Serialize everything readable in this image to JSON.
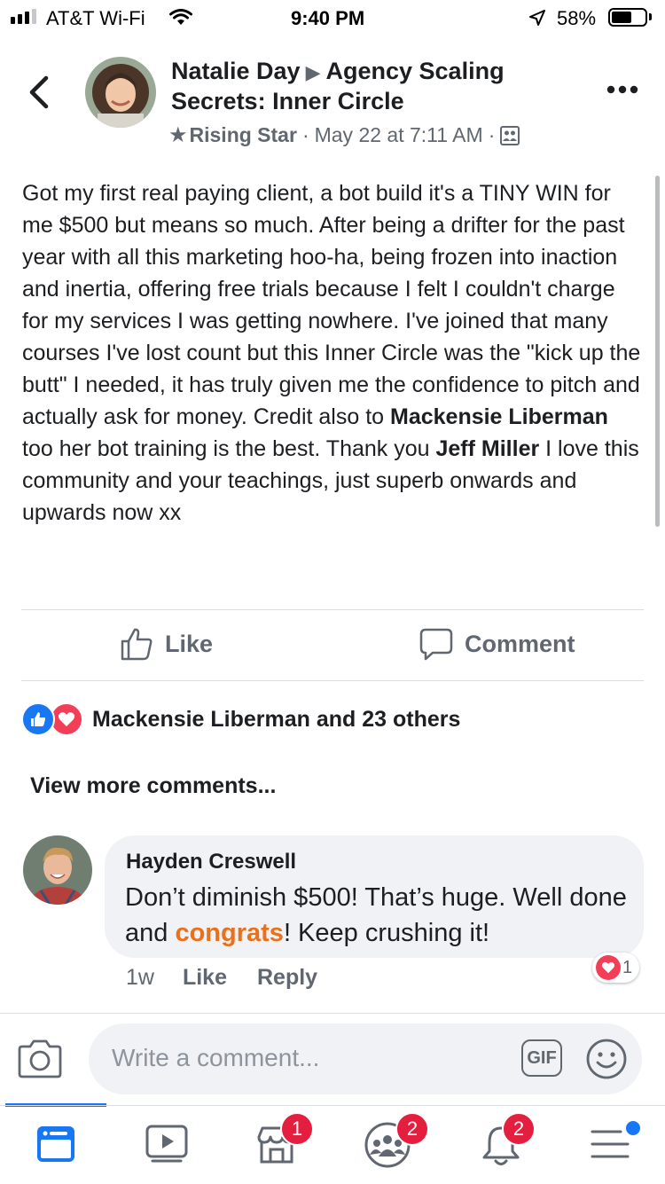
{
  "status_bar": {
    "carrier": "AT&T Wi-Fi",
    "time": "9:40 PM",
    "battery_percent": "58%"
  },
  "post": {
    "author": "Natalie Day",
    "group": "Agency Scaling Secrets: Inner Circle",
    "badge": "Rising Star",
    "separator": "·",
    "date": "May 22 at 7:11 AM",
    "text_1": "Got my first real paying client, a bot build it's a TINY WIN for me $500 but means so much.  After being a drifter for the past year with all this marketing hoo-ha, being frozen into inaction and inertia, offering free trials because I felt I couldn't charge for my services I was getting nowhere. I've joined that many courses I've lost count but this Inner Circle was the \"kick up the butt\" I needed, it has truly given me the confidence to pitch and actually ask for money. Credit also to ",
    "mention_1": "Mackensie Liberman",
    "text_2": " too her bot training is the best.  Thank you ",
    "mention_2": "Jeff Miller",
    "text_3": " I love this community and your teachings, just superb onwards and upwards now xx"
  },
  "actions": {
    "like": "Like",
    "comment": "Comment"
  },
  "reactions": {
    "summary": "Mackensie Liberman and 23 others"
  },
  "comments": {
    "view_more": "View more comments...",
    "items": [
      {
        "name": "Hayden Creswell",
        "text_before": "Don’t diminish $500! That’s huge. Well done and ",
        "highlight": "congrats",
        "text_after": "! Keep crushing it!",
        "age": "1w",
        "like": "Like",
        "reply": "Reply",
        "reaction_count": "1"
      }
    ]
  },
  "composer": {
    "placeholder": "Write a comment...",
    "gif": "GIF"
  },
  "tabbar": {
    "marketplace_badge": "1",
    "groups_badge": "2",
    "notifications_badge": "2"
  },
  "colors": {
    "facebook_blue": "#1877f2",
    "love_red": "#f33e58",
    "congrats_orange": "#e9711c"
  }
}
